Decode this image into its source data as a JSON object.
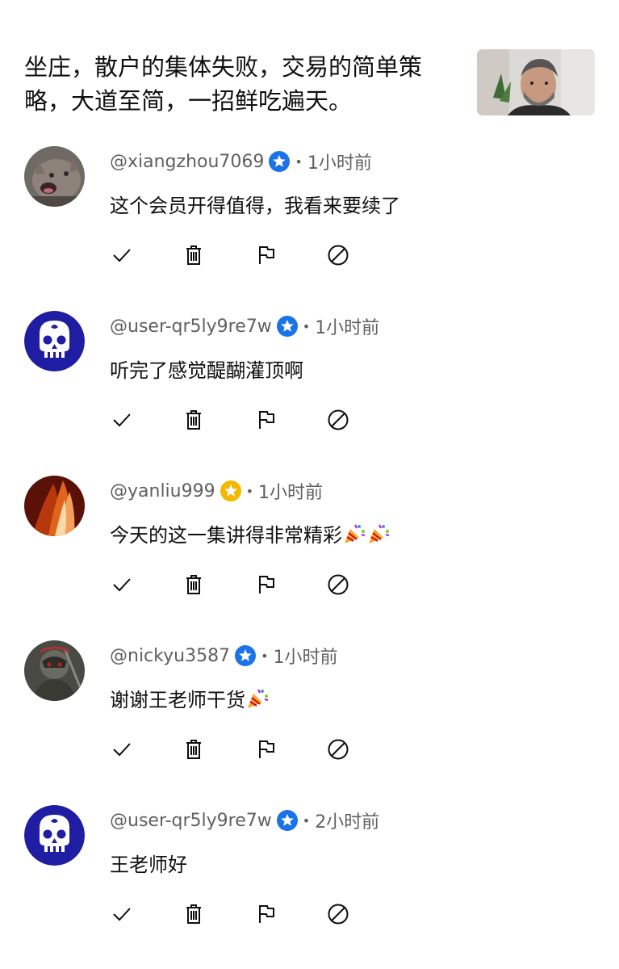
{
  "video": {
    "title": "坐庄，散户的集体失败，交易的简单策略，大道至简，一招鲜吃遍天。"
  },
  "comments": [
    {
      "handle": "@xiangzhou7069",
      "badge": "blue-star-badge",
      "separator": "•",
      "time": "1小时前",
      "text": "这个会员开得值得，我看来要续了",
      "emoji_count": 0
    },
    {
      "handle": "@user-qr5ly9re7w",
      "badge": "blue-star-badge",
      "separator": "•",
      "time": "1小时前",
      "text": "听完了感觉醍醐灌顶啊",
      "emoji_count": 0
    },
    {
      "handle": "@yanliu999",
      "badge": "gold-star-badge",
      "separator": "•",
      "time": "1小时前",
      "text": "今天的这一集讲得非常精彩",
      "emoji_count": 2
    },
    {
      "handle": "@nickyu3587",
      "badge": "blue-star-badge",
      "separator": "•",
      "time": "1小时前",
      "text": "谢谢王老师干货",
      "emoji_count": 1
    },
    {
      "handle": "@user-qr5ly9re7w",
      "badge": "blue-star-badge",
      "separator": "•",
      "time": "2小时前",
      "text": "王老师好",
      "emoji_count": 0
    }
  ],
  "icons": {
    "approve": "checkmark-icon",
    "delete": "trash-icon",
    "report": "flag-icon",
    "block": "block-icon",
    "emoji": "party-popper-icon"
  },
  "colors": {
    "blue_badge": "#1a73e8",
    "gold_badge": "#f5b800",
    "meta_text": "#606060",
    "body_text": "#0f0f0f",
    "skull_blue": "#1f1ea3"
  }
}
